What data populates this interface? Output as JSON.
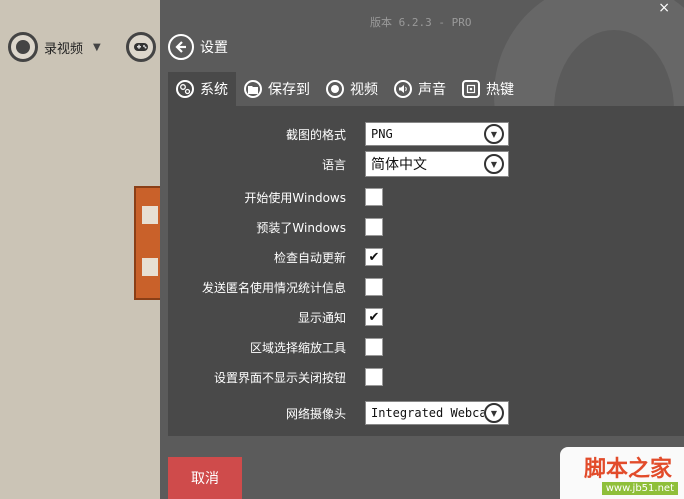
{
  "background_app": {
    "record_label": "录视频",
    "record_caret": "▼",
    "game_icon": "gamepad-icon"
  },
  "window": {
    "version": "版本 6.2.3 - PRO",
    "close": "×",
    "title": "设置",
    "back_icon": "arrow-left-icon"
  },
  "tabs": [
    {
      "label": "系统",
      "icon": "gears-icon"
    },
    {
      "label": "保存到",
      "icon": "folder-icon"
    },
    {
      "label": "视频",
      "icon": "record-icon"
    },
    {
      "label": "声音",
      "icon": "speaker-icon"
    },
    {
      "label": "热键",
      "icon": "hotkey-icon"
    }
  ],
  "settings": {
    "screenshot_format": {
      "label": "截图的格式",
      "value": "PNG"
    },
    "language": {
      "label": "语言",
      "value": "简体中文"
    },
    "start_with_windows": {
      "label": "开始使用Windows",
      "checked": false
    },
    "preinstalled_windows": {
      "label": "预装了Windows",
      "checked": false
    },
    "check_updates": {
      "label": "检查自动更新",
      "checked": true
    },
    "send_stats": {
      "label": "发送匿名使用情况统计信息",
      "checked": false
    },
    "show_notifications": {
      "label": "显示通知",
      "checked": true
    },
    "region_zoom": {
      "label": "区域选择缩放工具",
      "checked": false
    },
    "hide_close_button": {
      "label": "设置界面不显示关闭按钮",
      "checked": false
    },
    "webcam": {
      "label": "网络摄像头",
      "value": "Integrated Webcam"
    }
  },
  "footer": {
    "cancel_label": "取消"
  },
  "watermark": {
    "text": "脚本之家",
    "url": "www.jb51.net"
  },
  "colors": {
    "window_bg": "#5b5b5b",
    "panel_bg": "#494949",
    "cancel_bg": "#cf4b4b"
  },
  "check_mark": "✔"
}
